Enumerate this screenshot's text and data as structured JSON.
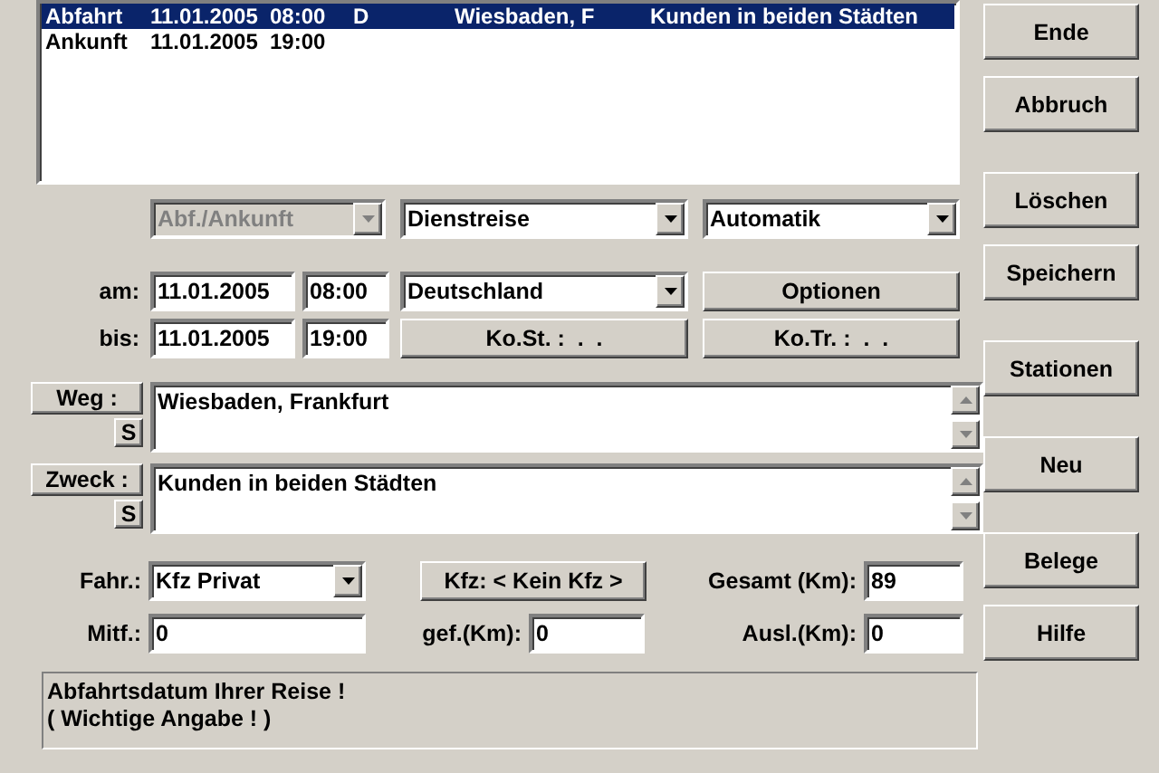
{
  "list": {
    "rows": [
      {
        "selected": true,
        "cells": [
          "Abfahrt",
          "11.01.2005",
          "08:00",
          "D",
          "Wiesbaden, F",
          "Kunden in beiden Städten"
        ]
      },
      {
        "selected": false,
        "cells": [
          "Ankunft",
          "11.01.2005",
          "19:00"
        ]
      }
    ]
  },
  "selectors": [
    {
      "value": "Abf./Ankunft",
      "disabled": true
    },
    {
      "value": "Dienstreise",
      "disabled": false
    },
    {
      "value": "Automatik",
      "disabled": false
    }
  ],
  "dates": [
    {
      "label": "am:",
      "date": "11.01.2005",
      "time": "08:00",
      "kind": "dropdown",
      "field": "Deutschland",
      "button": "Optionen"
    },
    {
      "label": "bis:",
      "date": "11.01.2005",
      "time": "19:00",
      "kind": "buttons",
      "field": "Ko.St. :  .  .",
      "button": "Ko.Tr. :  .  ."
    }
  ],
  "memos": [
    {
      "button": "Weg :",
      "s_button": "S",
      "value": "Wiesbaden, Frankfurt"
    },
    {
      "button": "Zweck :",
      "s_button": "S",
      "value": "Kunden in beiden Städten"
    }
  ],
  "vehicle": {
    "fahr_label": "Fahr.:",
    "fahr_value": "Kfz Privat",
    "kfz_button": "Kfz: < Kein Kfz >",
    "gesamt_label": "Gesamt (Km):",
    "gesamt_value": "89",
    "mitf_label": "Mitf.:",
    "mitf_value": "0",
    "gef_label": "gef.(Km):",
    "gef_value": "0",
    "ausl_label": "Ausl.(Km):",
    "ausl_value": "0"
  },
  "status_message": [
    "Abfahrtsdatum Ihrer Reise !",
    "( Wichtige Angabe ! )"
  ],
  "side_buttons": [
    {
      "label": "Ende"
    },
    {
      "label": "Abbruch"
    },
    {
      "label": "Löschen"
    },
    {
      "label": "Speichern"
    },
    {
      "label": "Stationen"
    },
    {
      "label": "Neu"
    },
    {
      "label": "Belege"
    },
    {
      "label": "Hilfe"
    }
  ]
}
